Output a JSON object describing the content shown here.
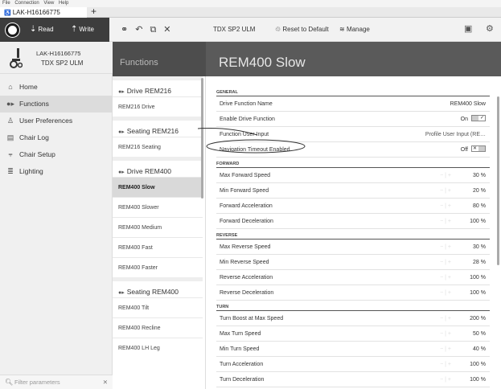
{
  "menu": [
    "File",
    "Connection",
    "View",
    "Help"
  ],
  "tab": {
    "title": "LAK-H16166775",
    "new": "+"
  },
  "toolbar": {
    "read": "Read",
    "write": "Write",
    "device_label": "TDX SP2 ULM",
    "reset": "Reset to Default",
    "manage": "Manage"
  },
  "device": {
    "id": "LAK-H16166775",
    "model": "TDX SP2 ULM"
  },
  "nav": [
    {
      "label": "Home",
      "icon": "home-icon",
      "glyph": "⌂"
    },
    {
      "label": "Functions",
      "icon": "functions-icon",
      "glyph": "●▸",
      "active": true
    },
    {
      "label": "User Preferences",
      "icon": "user-icon",
      "glyph": "♙"
    },
    {
      "label": "Chair Log",
      "icon": "log-icon",
      "glyph": "▤"
    },
    {
      "label": "Chair Setup",
      "icon": "setup-icon",
      "glyph": "⫧"
    },
    {
      "label": "Lighting",
      "icon": "lighting-icon",
      "glyph": "≣"
    }
  ],
  "filter": {
    "placeholder": "Filter parameters"
  },
  "functions": {
    "title": "Functions",
    "groups": [
      {
        "label": "Drive REM216",
        "items": [
          "REM216 Drive"
        ]
      },
      {
        "label": "Seating REM216",
        "items": [
          "REM216 Seating"
        ]
      },
      {
        "label": "Drive REM400",
        "items": [
          "REM400 Slow",
          "REM400 Slower",
          "REM400 Medium",
          "REM400 Fast",
          "REM400 Faster"
        ]
      },
      {
        "label": "Seating REM400",
        "items": [
          "REM400 Tilt",
          "REM400 Recline",
          "REM400 LH Leg"
        ]
      }
    ],
    "selected": "REM400 Slow"
  },
  "main": {
    "title": "REM400 Slow",
    "sections": [
      {
        "name": "GENERAL",
        "rows": [
          {
            "label": "Drive Function Name",
            "value": "REM400 Slow",
            "kind": "text"
          },
          {
            "label": "Enable Drive Function",
            "value": "On",
            "kind": "toggle-on"
          },
          {
            "label": "Function User Input",
            "value": "Profile User Input (RE…",
            "kind": "select"
          },
          {
            "label": "Navigation Timeout Enabled",
            "value": "Off",
            "kind": "toggle-off"
          }
        ]
      },
      {
        "name": "FORWARD",
        "rows": [
          {
            "label": "Max Forward Speed",
            "value": "30 %",
            "kind": "step"
          },
          {
            "label": "Min Forward Speed",
            "value": "20 %",
            "kind": "step"
          },
          {
            "label": "Forward Acceleration",
            "value": "80 %",
            "kind": "step"
          },
          {
            "label": "Forward Deceleration",
            "value": "100 %",
            "kind": "step"
          }
        ]
      },
      {
        "name": "REVERSE",
        "rows": [
          {
            "label": "Max Reverse Speed",
            "value": "30 %",
            "kind": "step"
          },
          {
            "label": "Min Reverse Speed",
            "value": "28 %",
            "kind": "step"
          },
          {
            "label": "Reverse Acceleration",
            "value": "100 %",
            "kind": "step"
          },
          {
            "label": "Reverse Deceleration",
            "value": "100 %",
            "kind": "step"
          }
        ]
      },
      {
        "name": "TURN",
        "rows": [
          {
            "label": "Turn Boost at Max Speed",
            "value": "200 %",
            "kind": "step"
          },
          {
            "label": "Max Turn Speed",
            "value": "50 %",
            "kind": "step"
          },
          {
            "label": "Min Turn Speed",
            "value": "40 %",
            "kind": "step"
          },
          {
            "label": "Turn Acceleration",
            "value": "100 %",
            "kind": "step"
          },
          {
            "label": "Turn Deceleration",
            "value": "100 %",
            "kind": "step"
          }
        ]
      }
    ]
  },
  "colors": {
    "dark": "#3d3d3d",
    "header": "#5a5a5a",
    "accent": "#555555"
  }
}
